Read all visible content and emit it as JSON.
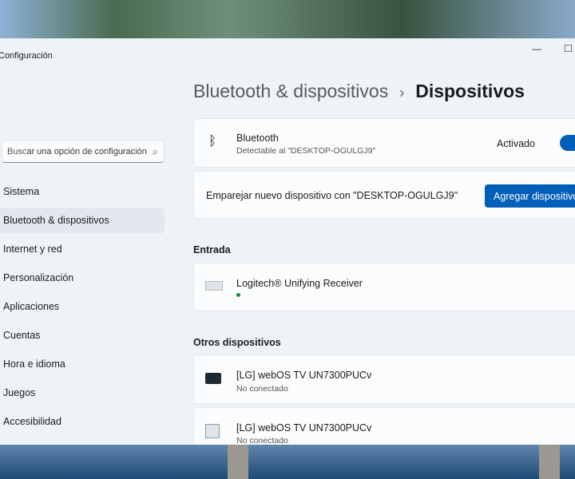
{
  "window": {
    "title": "Configuración"
  },
  "search": {
    "placeholder": "Buscar una opción de configuración",
    "visible_text": "ar una opción de configuración"
  },
  "nav": [
    "Sistema",
    "Bluetooth & dispositivos",
    "Internet y red",
    "Personalización",
    "Aplicaciones",
    "Cuentas",
    "Hora e idioma",
    "Juegos",
    "Accesibilidad"
  ],
  "header": {
    "parent": "Bluetooth & dispositivos",
    "current": "Dispositivos"
  },
  "bluetooth": {
    "title": "Bluetooth",
    "subtitle": "Detectable al \"DESKTOP-OGULGJ9\"",
    "state": "Activado"
  },
  "pair": {
    "text": "Emparejar nuevo dispositivo con \"DESKTOP-OGULGJ9\"",
    "button": "Agregar dispositivo"
  },
  "sections": {
    "input": "Entrada",
    "other": "Otros dispositivos"
  },
  "devices": [
    {
      "name": "Logitech® Unifying Receiver",
      "status": ""
    },
    {
      "name": "[LG] webOS TV UN7300PUCv",
      "status": "No conectado"
    },
    {
      "name": "[LG] webOS TV UN7300PUCv",
      "status": "No conectado"
    }
  ]
}
